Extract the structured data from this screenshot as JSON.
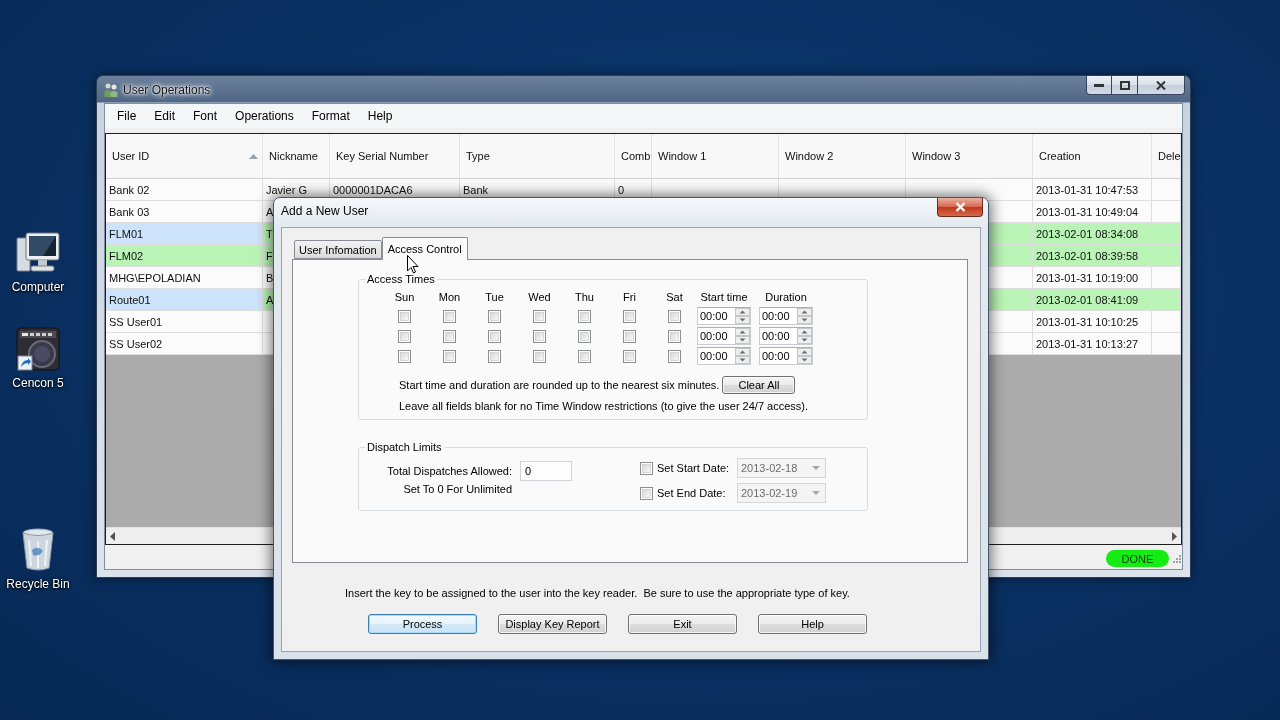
{
  "desktop": {
    "icons": [
      {
        "kind": "computer",
        "label": "Computer"
      },
      {
        "kind": "shortcut",
        "label": "Cencon 5"
      },
      {
        "kind": "recycle-bin",
        "label": "Recycle Bin"
      }
    ]
  },
  "main_window": {
    "title": "User Operations",
    "menu": [
      "File",
      "Edit",
      "Font",
      "Operations",
      "Format",
      "Help"
    ],
    "table": {
      "columns": [
        {
          "label": "User ID",
          "sorted": true
        },
        {
          "label": "Nickname",
          "sorted": false
        },
        {
          "label": "Key Serial Number",
          "sorted": false
        },
        {
          "label": "Type",
          "sorted": false
        },
        {
          "label": "Comb",
          "sorted": false
        },
        {
          "label": "Window 1",
          "sorted": false
        },
        {
          "label": "Window 2",
          "sorted": false
        },
        {
          "label": "Window 3",
          "sorted": false
        },
        {
          "label": "Creation",
          "sorted": false
        },
        {
          "label": "Dele",
          "sorted": false
        }
      ],
      "rows": [
        {
          "user_id": "Bank 02",
          "nickname": "Javier G",
          "key_serial_number": "0000001DACA6",
          "type": "Bank",
          "comb": "0",
          "creation": "2013-01-31 10:47:53",
          "selected": false,
          "highlighted": false
        },
        {
          "user_id": "Bank 03",
          "nickname": "A",
          "creation": "2013-01-31 10:49:04",
          "selected": false,
          "highlighted": false
        },
        {
          "user_id": "FLM01",
          "nickname": "T",
          "creation": "2013-02-01 08:34:08",
          "selected": true,
          "highlighted": true
        },
        {
          "user_id": "FLM02",
          "nickname": "F",
          "creation": "2013-02-01 08:39:58",
          "selected": false,
          "highlighted": true
        },
        {
          "user_id": "MHG\\EPOLADIAN",
          "nickname": "B",
          "creation": "2013-01-31 10:19:00",
          "selected": false,
          "highlighted": false
        },
        {
          "user_id": "Route01",
          "nickname": "A",
          "creation": "2013-02-01 08:41:09",
          "selected": true,
          "highlighted": true
        },
        {
          "user_id": "SS User01",
          "creation": "2013-01-31 10:10:25",
          "selected": false,
          "highlighted": false
        },
        {
          "user_id": "SS User02",
          "creation": "2013-01-31 10:13:27",
          "selected": false,
          "highlighted": false
        }
      ]
    },
    "status_bar": {
      "status": "DONE"
    }
  },
  "dialog": {
    "title": "Add a New User",
    "tabs": [
      {
        "label": "User Infomation",
        "selected": false
      },
      {
        "label": "Access Control",
        "selected": true
      }
    ],
    "access_times": {
      "title": "Access Times",
      "days": [
        "Sun",
        "Mon",
        "Tue",
        "Wed",
        "Thu",
        "Fri",
        "Sat"
      ],
      "start_time_label": "Start time",
      "duration_label": "Duration",
      "windows": [
        {
          "days": [
            {
              "checked": false
            },
            {
              "checked": false
            },
            {
              "checked": false
            },
            {
              "checked": false
            },
            {
              "checked": false
            },
            {
              "checked": false
            },
            {
              "checked": false
            }
          ],
          "start_time": "00:00",
          "duration": "00:00"
        },
        {
          "days": [
            {
              "checked": false
            },
            {
              "checked": false
            },
            {
              "checked": false
            },
            {
              "checked": false
            },
            {
              "checked": false
            },
            {
              "checked": false
            },
            {
              "checked": false
            }
          ],
          "start_time": "00:00",
          "duration": "00:00"
        },
        {
          "days": [
            {
              "checked": false
            },
            {
              "checked": false
            },
            {
              "checked": false
            },
            {
              "checked": false
            },
            {
              "checked": false
            },
            {
              "checked": false
            },
            {
              "checked": false
            }
          ],
          "start_time": "00:00",
          "duration": "00:00"
        }
      ],
      "rounding_note": "Start time and duration are rounded up to the nearest six minutes.",
      "clear_button": "Clear All",
      "blank_note": "Leave all fields blank for no Time Window restrictions (to give the user 24/7 access)."
    },
    "dispatch_limits": {
      "title": "Dispatch Limits",
      "total_label": "Total Dispatches Allowed:",
      "total_value": "0",
      "unlimited_note": "Set To 0 For Unlimited",
      "dates": [
        {
          "label": "Set Start Date:",
          "checked": false,
          "disabled": true,
          "value": "2013-02-18"
        },
        {
          "label": "Set End Date:",
          "checked": false,
          "disabled": true,
          "value": "2013-02-19"
        }
      ]
    },
    "instruction": "Insert the key to be assigned to the user into the key reader.  Be sure to use the appropriate type of key.",
    "buttons": [
      {
        "label": "Process",
        "focused": true
      },
      {
        "label": "Display Key Report",
        "focused": false
      },
      {
        "label": "Exit",
        "focused": false
      },
      {
        "label": "Help",
        "focused": false
      }
    ]
  }
}
